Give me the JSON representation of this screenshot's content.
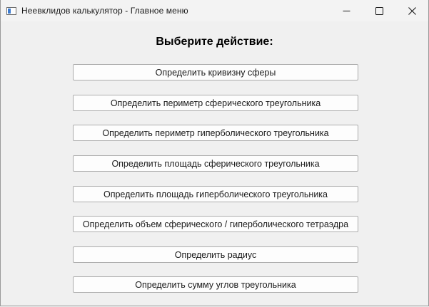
{
  "window": {
    "title": "Неевклидов калькулятор - Главное меню",
    "icon": "app-window-icon",
    "controls": [
      "minimize-icon",
      "maximize-icon",
      "close-icon"
    ]
  },
  "main": {
    "heading": "Выберите действие:",
    "buttons": [
      "Определить кривизну сферы",
      "Определить периметр сферического треугольника",
      "Определить периметр гиперболического треугольника",
      "Определить площадь сферического треугольника",
      "Определить площадь гиперболического треугольника",
      "Определить объем сферического / гиперболического тетраэдра",
      "Определить радиус",
      "Определить сумму углов треугольника"
    ]
  }
}
